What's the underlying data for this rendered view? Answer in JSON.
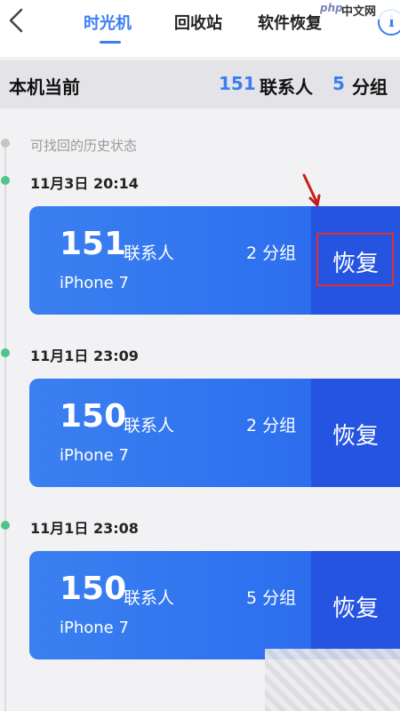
{
  "nav": {
    "tabs": [
      {
        "label": "时光机",
        "active": true
      },
      {
        "label": "回收站",
        "active": false
      },
      {
        "label": "软件恢复",
        "active": false
      }
    ],
    "info_label": "i"
  },
  "watermark": {
    "brand": "php",
    "site": "中文网"
  },
  "summary": {
    "title": "本机当前",
    "contacts_count": "151",
    "contacts_label": "联系人",
    "groups_count": "5",
    "groups_label": "分组"
  },
  "history": {
    "label": "可找回的历史状态",
    "snapshots": [
      {
        "timestamp": "11月3日  20:14",
        "count": "151",
        "contacts_label": "联系人",
        "groups": "2 分组",
        "device": "iPhone 7",
        "restore_label": "恢复",
        "highlighted": true
      },
      {
        "timestamp": "11月1日  23:09",
        "count": "150",
        "contacts_label": "联系人",
        "groups": "2 分组",
        "device": "iPhone 7",
        "restore_label": "恢复",
        "highlighted": false
      },
      {
        "timestamp": "11月1日  23:08",
        "count": "150",
        "contacts_label": "联系人",
        "groups": "5 分组",
        "device": "iPhone 7",
        "restore_label": "恢复",
        "highlighted": false
      }
    ]
  },
  "colors": {
    "accent": "#3a7ef0",
    "card": "#3b80f0",
    "restore_button": "#2555e0",
    "timeline_dot": "#4fc58a",
    "annotation": "#e0302c"
  },
  "icons": {
    "back": "chevron-left-icon",
    "info": "info-circle-icon"
  }
}
